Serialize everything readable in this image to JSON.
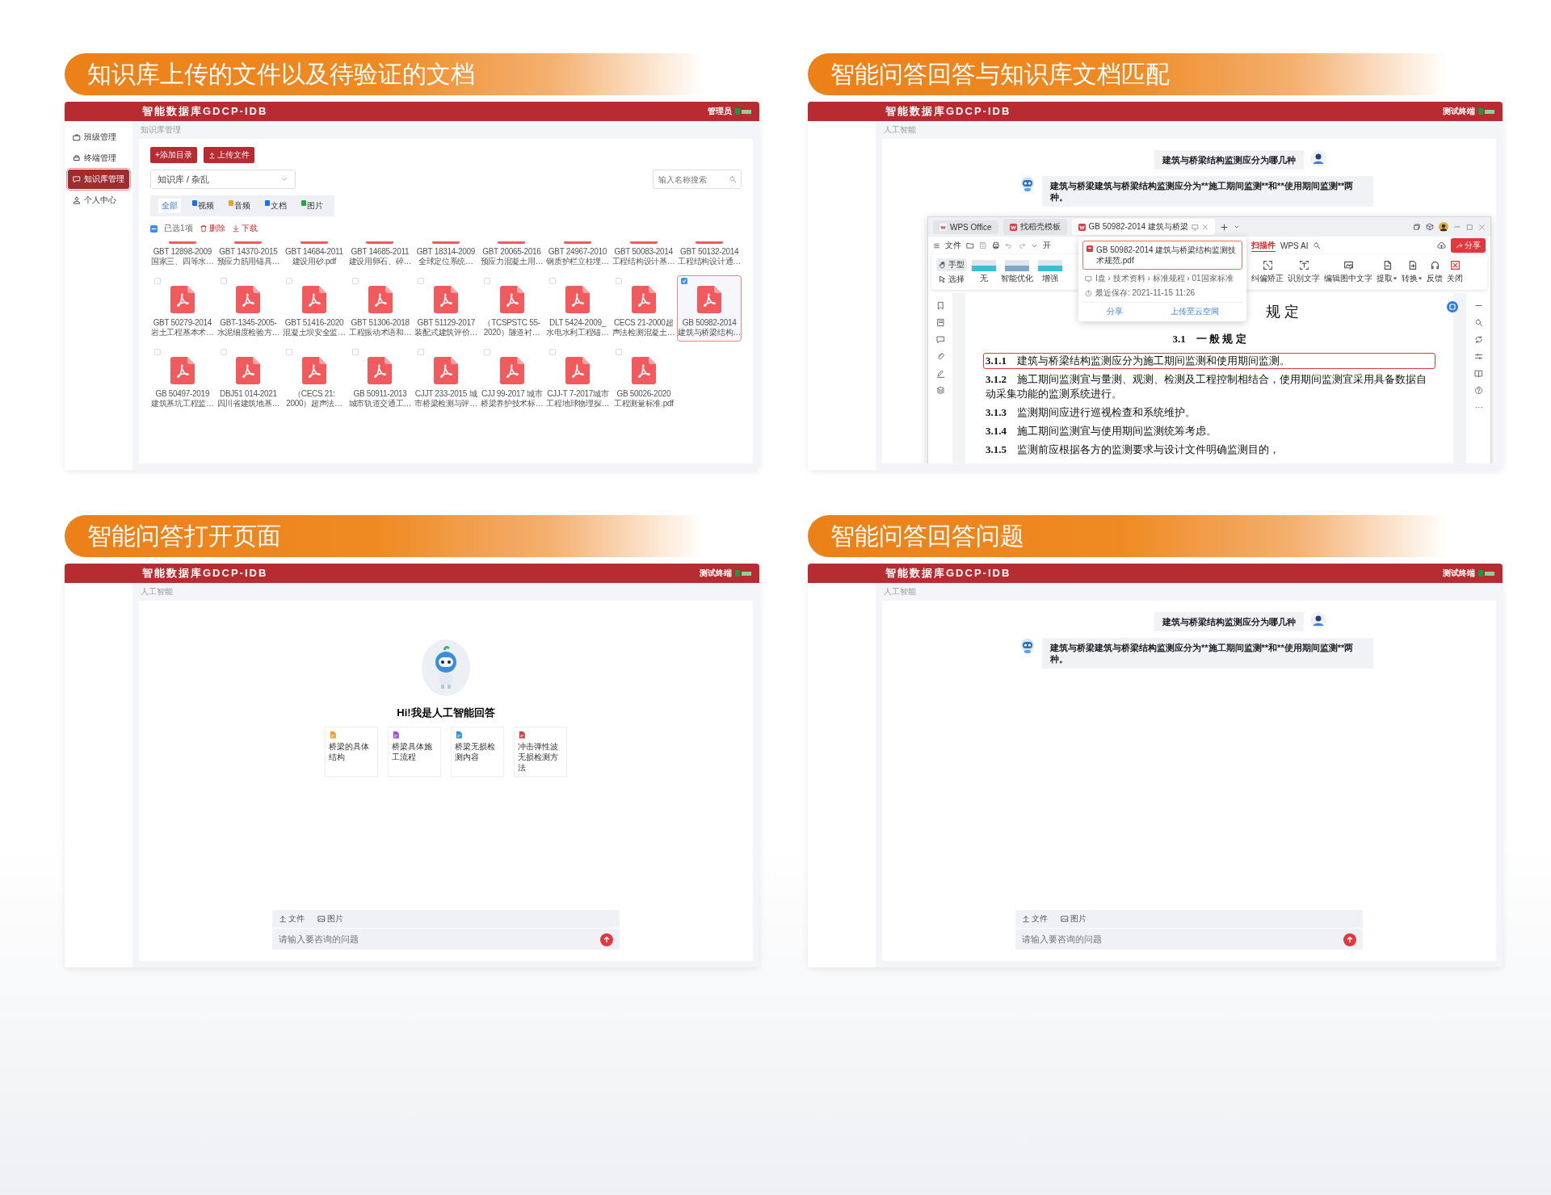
{
  "sections": [
    {
      "kind": "library",
      "title": "知识库上传的文件以及待验证的文档",
      "app": {
        "title": "智能数据库GDCP-IDB",
        "user": "管理员"
      },
      "sidebar": [
        {
          "label": "班级管理",
          "selected": false
        },
        {
          "label": "终端管理",
          "selected": false
        },
        {
          "label": "知识库管理",
          "selected": true
        },
        {
          "label": "个人中心",
          "selected": false
        }
      ],
      "breadcrumb": "知识库管理",
      "buttons": [
        {
          "label": "+添加目录",
          "kind": "add"
        },
        {
          "label": "上传文件",
          "kind": "upload"
        }
      ],
      "folder_select": {
        "value": "知识库 / 杂乱"
      },
      "search": {
        "placeholder": "输入名称搜索"
      },
      "filter_tabs": [
        {
          "label": "全部",
          "selected": true
        },
        {
          "label": "视频",
          "selected": false,
          "color": "#1f6fe5"
        },
        {
          "label": "音频",
          "selected": false,
          "color": "#f0a020"
        },
        {
          "label": "文档",
          "selected": false,
          "color": "#1f6fe5"
        },
        {
          "label": "图片",
          "selected": false,
          "color": "#22a83a"
        }
      ],
      "selection": {
        "count": "已选1项",
        "actions": [
          {
            "label": "删除",
            "kind": "delete"
          },
          {
            "label": "下载",
            "kind": "download"
          }
        ]
      },
      "file_rows": [
        {
          "cut": true,
          "files": [
            {
              "name": [
                "GBT 12898-2009",
                "国家三、四等水…"
              ],
              "selected": false
            },
            {
              "name": [
                "GBT 14370-2015",
                "预应力筋用锚具…"
              ],
              "selected": false
            },
            {
              "name": [
                "GBT 14684-2011",
                "建设用砂.pdf"
              ],
              "selected": false
            },
            {
              "name": [
                "GBT 14685-2011",
                "建设用卵石、碎…"
              ],
              "selected": false
            },
            {
              "name": [
                "GBT 18314-2009",
                "全球定位系统…"
              ],
              "selected": false
            },
            {
              "name": [
                "GBT 20065-2016",
                "预应力混凝土用…"
              ],
              "selected": false
            },
            {
              "name": [
                "GBT 24967-2010",
                "钢质护栏立柱埋…"
              ],
              "selected": false
            },
            {
              "name": [
                "GBT 50083-2014",
                "工程结构设计基…"
              ],
              "selected": false
            },
            {
              "name": [
                "GBT 50132-2014",
                "工程结构设计通…"
              ],
              "selected": false
            }
          ]
        },
        {
          "cut": false,
          "files": [
            {
              "name": [
                "GBT 50279-2014",
                "岩土工程基本术…"
              ],
              "selected": false
            },
            {
              "name": [
                "GBT-1345-2005-",
                "水泥细度检验方…"
              ],
              "selected": false
            },
            {
              "name": [
                "GBT 51416-2020",
                "混凝土坝安全监…"
              ],
              "selected": false
            },
            {
              "name": [
                "GBT 51306-2018",
                "工程振动术语和…"
              ],
              "selected": false
            },
            {
              "name": [
                "GBT 51129-2017",
                "装配式建筑评价…"
              ],
              "selected": false
            },
            {
              "name": [
                "（TCSPSTC 55-",
                "2020）隧道衬…"
              ],
              "selected": false
            },
            {
              "name": [
                "DLT 5424-2009_",
                "水电水利工程锚…"
              ],
              "selected": false
            },
            {
              "name": [
                "CECS 21-2000超",
                "声法检测混凝土…"
              ],
              "selected": false
            },
            {
              "name": [
                "GB 50982-2014",
                "建筑与桥梁结构…"
              ],
              "selected": true
            }
          ]
        },
        {
          "cut": false,
          "files": [
            {
              "name": [
                "GB 50497-2019",
                "建筑基坑工程监…"
              ],
              "selected": false
            },
            {
              "name": [
                "DBJ51 014-2021",
                "四川省建筑地基…"
              ],
              "selected": false
            },
            {
              "name": [
                "（CECS 21:",
                "2000）超声法…"
              ],
              "selected": false
            },
            {
              "name": [
                "GB 50911-2013",
                "城市轨道交通工…"
              ],
              "selected": false
            },
            {
              "name": [
                "CJJT 233-2015 城",
                "市桥梁检测与评…"
              ],
              "selected": false
            },
            {
              "name": [
                "CJJ 99-2017 城市",
                "桥梁养护技术标…"
              ],
              "selected": false
            },
            {
              "name": [
                "CJJ-T 7-2017城市",
                "工程地球物理探…"
              ],
              "selected": false
            },
            {
              "name": [
                "GB 50026-2020",
                "工程测量标准.pdf"
              ],
              "selected": false
            }
          ]
        }
      ]
    },
    {
      "kind": "match",
      "title": "智能问答回答与知识库文档匹配",
      "app": {
        "title": "智能数据库GDCP-IDB",
        "user": "测试终端"
      },
      "breadcrumb": "人工智能",
      "chat": [
        {
          "kind": "user",
          "text": "建筑与桥梁结构监测应分为哪几种"
        },
        {
          "kind": "bot",
          "text": "建筑与桥梁建筑与桥梁结构监测应分为**施工期间监测**和**使用期间监测**两种。"
        }
      ],
      "wps": {
        "tabs": [
          {
            "label": "WPS Office",
            "selected": false
          },
          {
            "label": "找稻壳模板",
            "selected": false
          },
          {
            "label": "GB 50982-2014 建筑与桥梁",
            "selected": true
          }
        ],
        "menu_left": [
          "文件",
          "开"
        ],
        "menu_right": [
          {
            "label": "扫描件",
            "selected": true
          },
          {
            "label": "WPS AI",
            "selected": false
          }
        ],
        "share": "分享",
        "modes": [
          {
            "label": "手型",
            "selected": true
          },
          {
            "label": "选择",
            "selected": false
          }
        ],
        "filters": [
          "无",
          "智能优化",
          "增强"
        ],
        "tools": [
          {
            "label": "纠偏矫正",
            "menu": false
          },
          {
            "label": "识别文字",
            "menu": false
          },
          {
            "label": "编辑图中文字",
            "menu": false
          },
          {
            "label": "提取",
            "menu": true
          },
          {
            "label": "转换",
            "menu": true
          },
          {
            "label": "反馈",
            "menu": false
          },
          {
            "label": "关闭",
            "menu": false
          }
        ],
        "popup": {
          "file": "GB 50982-2014 建筑与桥梁结构监测技术规范.pdf",
          "path": "I盘 › 技术资料 › 标准规程 › 01国家标准",
          "saved": "最近保存: 2021-11-15 11:26",
          "links": [
            "分享",
            "上传至云空间"
          ]
        },
        "document": {
          "heading": "规 定",
          "section": "3.1　一 般 规 定",
          "clauses": [
            {
              "number": "3.1.1",
              "text": "建筑与桥梁结构监测应分为施工期间监测和使用期间监测。",
              "highlighted": true
            },
            {
              "number": "3.1.2",
              "text": "施工期间监测宜与量测、观测、检测及工程控制相结合，使用期间监测宜采用具备数据自动采集功能的监测系统进行。",
              "highlighted": false
            },
            {
              "number": "3.1.3",
              "text": "监测期间应进行巡视检查和系统维护。",
              "highlighted": false
            },
            {
              "number": "3.1.4",
              "text": "施工期间监测宜与使用期间监测统筹考虑。",
              "highlighted": false
            },
            {
              "number": "3.1.5",
              "text": "监测前应根据各方的监测要求与设计文件明确监测目的，",
              "highlighted": false
            }
          ]
        }
      }
    },
    {
      "kind": "welcome",
      "title": "智能问答打开页面",
      "app": {
        "title": "智能数据库GDCP-IDB",
        "user": "测试终端"
      },
      "breadcrumb": "人工智能",
      "greeting": "Hi!我是人工智能回答",
      "suggestions": [
        {
          "text": "桥梁的具体结构",
          "color": "#f0a030"
        },
        {
          "text": "桥梁具体施工流程",
          "color": "#a050e0"
        },
        {
          "text": "桥梁无损检测内容",
          "color": "#3090e0"
        },
        {
          "text": "冲击弹性波无损检测方法",
          "color": "#d04040"
        }
      ],
      "composer": {
        "attach": [
          {
            "label": "文件",
            "kind": "file"
          },
          {
            "label": "图片",
            "kind": "image"
          }
        ],
        "placeholder": "请输入要咨询的问题"
      }
    },
    {
      "kind": "chat",
      "title": "智能问答回答问题",
      "app": {
        "title": "智能数据库GDCP-IDB",
        "user": "测试终端"
      },
      "breadcrumb": "人工智能",
      "chat": [
        {
          "kind": "user",
          "text": "建筑与桥梁结构监测应分为哪几种"
        },
        {
          "kind": "bot",
          "text": "建筑与桥梁建筑与桥梁结构监测应分为**施工期间监测**和**使用期间监测**两种。"
        }
      ],
      "composer": {
        "attach": [
          {
            "label": "文件",
            "kind": "file"
          },
          {
            "label": "图片",
            "kind": "image"
          }
        ],
        "placeholder": "请输入要咨询的问题"
      }
    }
  ]
}
